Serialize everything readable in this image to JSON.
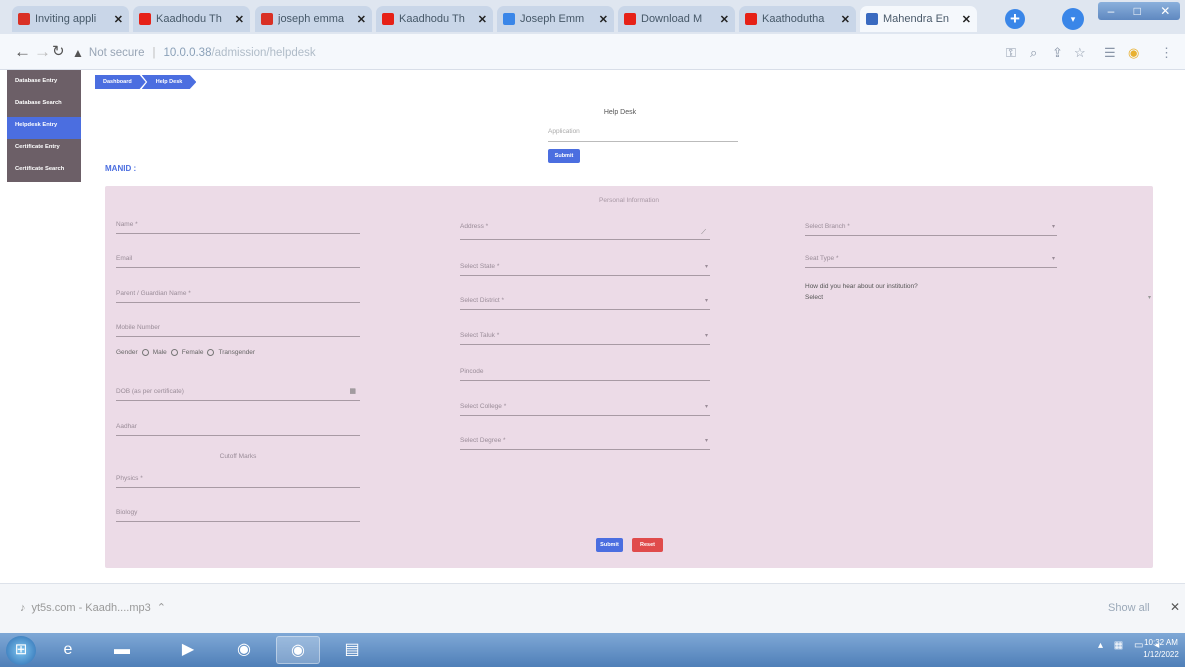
{
  "browser": {
    "tabs": [
      {
        "label": "Inviting appli",
        "icon": "gmail-icon",
        "color": "#d93025"
      },
      {
        "label": "Kaadhodu Th",
        "icon": "youtube-icon",
        "color": "#e62117"
      },
      {
        "label": "joseph emma",
        "icon": "gmail-icon",
        "color": "#d93025"
      },
      {
        "label": "Kaadhodu Th",
        "icon": "youtube-icon",
        "color": "#e62117"
      },
      {
        "label": "Joseph Emm",
        "icon": "globe-icon",
        "color": "#3a86e8"
      },
      {
        "label": "Download M",
        "icon": "download-site-icon",
        "color": "#e62117"
      },
      {
        "label": "Kaathodutha",
        "icon": "site-icon",
        "color": "#e62117"
      },
      {
        "label": "Mahendra En",
        "icon": "college-icon",
        "color": "#3a6ac0",
        "active": true
      }
    ],
    "new_tab": "+",
    "address": {
      "warning": "Not secure",
      "host": "10.0.0.38",
      "path": "/admission/helpdesk"
    }
  },
  "sidebar": {
    "items": [
      {
        "label": "Database Entry"
      },
      {
        "label": "Database Search"
      },
      {
        "label": "Helpdesk Entry",
        "active": true
      },
      {
        "label": "Certificate Entry"
      },
      {
        "label": "Certificate Search"
      }
    ]
  },
  "breadcrumb": [
    "Dashboard",
    "Help Desk"
  ],
  "help": {
    "title": "Help Desk",
    "app_no_placeholder": "Application",
    "submit": "Submit"
  },
  "manid_label": "MANID :",
  "form": {
    "title": "Personal Information",
    "left": {
      "name": "Name *",
      "email": "Email",
      "parent_name": "Parent / Guardian Name *",
      "mobile": "Mobile Number",
      "gender_label": "Gender",
      "gender_options": [
        "Male",
        "Female",
        "Transgender"
      ],
      "dob": "DOB (as per certificate)",
      "aadhar": "Aadhar",
      "cutoff_title": "Cutoff Marks",
      "physics": "Physics *",
      "biology": "Biology"
    },
    "middle": {
      "address": "Address *",
      "state": "Select State *",
      "district": "Select District *",
      "taluk": "Select Taluk *",
      "pincode": "Pincode",
      "college": "Select College *",
      "degree": "Select Degree *"
    },
    "right": {
      "branch": "Select Branch *",
      "seat_type": "Seat Type *",
      "how_heard": "How did you hear about our institution?",
      "how_heard_value": "Select"
    },
    "submit": "Submit",
    "reset": "Reset"
  },
  "downloads": {
    "file": "yt5s.com - Kaadh....mp3",
    "show_all": "Show all"
  },
  "taskbar": {
    "time": "10:32 AM",
    "date": "1/12/2022"
  }
}
